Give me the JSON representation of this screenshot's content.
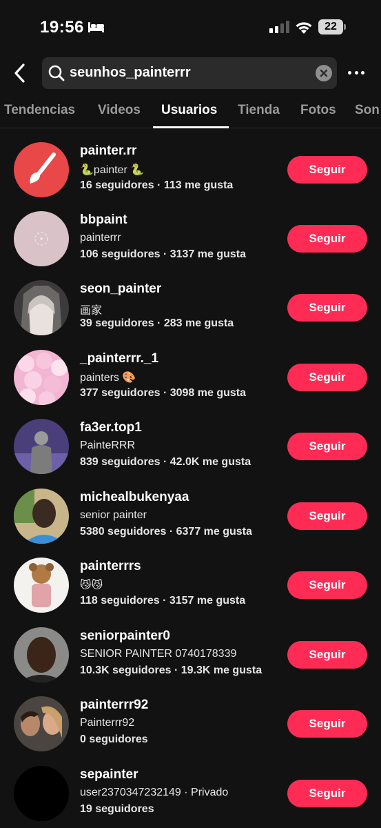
{
  "status_bar": {
    "time": "19:56",
    "battery": "22"
  },
  "search": {
    "query": "seunhos_painterrr"
  },
  "tabs": [
    {
      "label": "Tendencias"
    },
    {
      "label": "Videos"
    },
    {
      "label": "Usuarios",
      "active": true
    },
    {
      "label": "Tienda"
    },
    {
      "label": "Fotos"
    },
    {
      "label": "Son"
    }
  ],
  "users": [
    {
      "username": "painter.rr",
      "bio": "🐍painter 🐍",
      "stats": "16 seguidores · 113 me gusta",
      "follow_label": "Seguir"
    },
    {
      "username": "bbpaint",
      "bio": "painterrr",
      "stats": "106 seguidores · 3137 me gusta",
      "follow_label": "Seguir"
    },
    {
      "username": "seon_painter",
      "bio": "画家",
      "stats": "39 seguidores · 283 me gusta",
      "follow_label": "Seguir"
    },
    {
      "username": "_painterrr._1",
      "bio": "painters 🎨",
      "stats": "377 seguidores · 3098 me gusta",
      "follow_label": "Seguir"
    },
    {
      "username": "fa3er.top1",
      "bio": "PainteRRR",
      "stats": "839 seguidores · 42.0K me gusta",
      "follow_label": "Seguir"
    },
    {
      "username": "michealbukenyaa",
      "bio": "senior painter",
      "stats": "5380 seguidores · 6377 me gusta",
      "follow_label": "Seguir"
    },
    {
      "username": "painterrrs",
      "bio": "😼😼",
      "stats": "118 seguidores · 3157 me gusta",
      "follow_label": "Seguir"
    },
    {
      "username": "seniorpainter0",
      "bio": "SENIOR PAINTER 0740178339",
      "stats": "10.3K seguidores · 19.3K me gusta",
      "follow_label": "Seguir"
    },
    {
      "username": "painterrr92",
      "bio": "Painterrr92",
      "stats": "0 seguidores",
      "follow_label": "Seguir"
    },
    {
      "username": "sepainter",
      "bio": "user2370347232149 · Privado",
      "stats": "19 seguidores",
      "follow_label": "Seguir"
    }
  ],
  "colors": {
    "background": "#121212",
    "accent": "#fe2c55",
    "search_bg": "#2b2b2b"
  }
}
